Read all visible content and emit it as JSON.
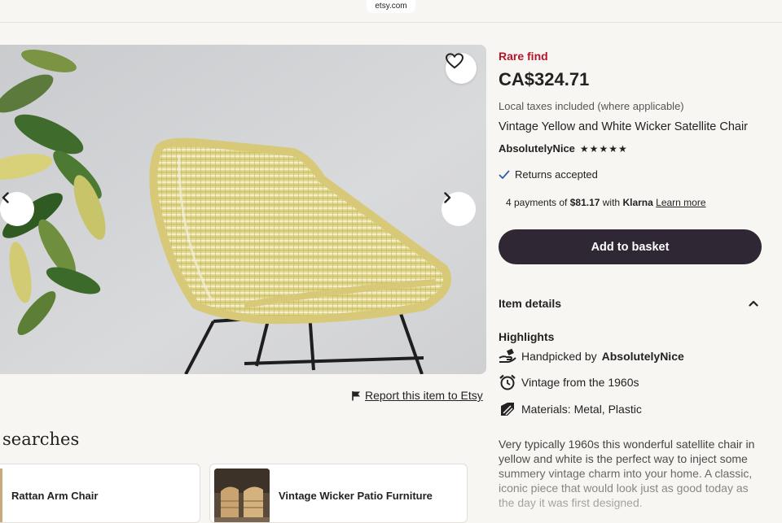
{
  "browser": {
    "url": "etsy.com"
  },
  "listing": {
    "badge": "Rare find",
    "price": "CA$324.71",
    "taxes_note": "Local taxes included (where applicable)",
    "title": "Vintage Yellow and White Wicker Satellite Chair",
    "seller": "AbsolutelyNice",
    "rating": 5,
    "rating_stars": "★★★★★",
    "returns": "Returns accepted",
    "klarna": {
      "prefix": "4 payments of",
      "amount": "$81.17",
      "with": "with",
      "brand": "Klarna",
      "link": "Learn more"
    },
    "add_to_basket": "Add to basket",
    "item_details": "Item details",
    "highlights_title": "Highlights",
    "highlights": {
      "handpicked_prefix": "Handpicked by",
      "handpicked_seller": "AbsolutelyNice",
      "vintage": "Vintage from the 1960s",
      "materials": "Materials: Metal, Plastic"
    },
    "description": "Very typically 1960s this wonderful satellite chair in yellow and white is the perfect way to inject some summery vintage charm into your home. A classic, iconic piece that would look just as good today as the day it was first designed."
  },
  "gallery": {
    "report_link": "Report this item to Etsy"
  },
  "related_searches": {
    "title_fragment": "searches",
    "items": [
      {
        "label": "Rattan Arm Chair"
      },
      {
        "label": "Vintage Wicker Patio Furniture"
      }
    ]
  },
  "colors": {
    "accent_red": "#b3162b",
    "button_dark": "#2f2733",
    "page_bg": "#f8f6f2"
  }
}
